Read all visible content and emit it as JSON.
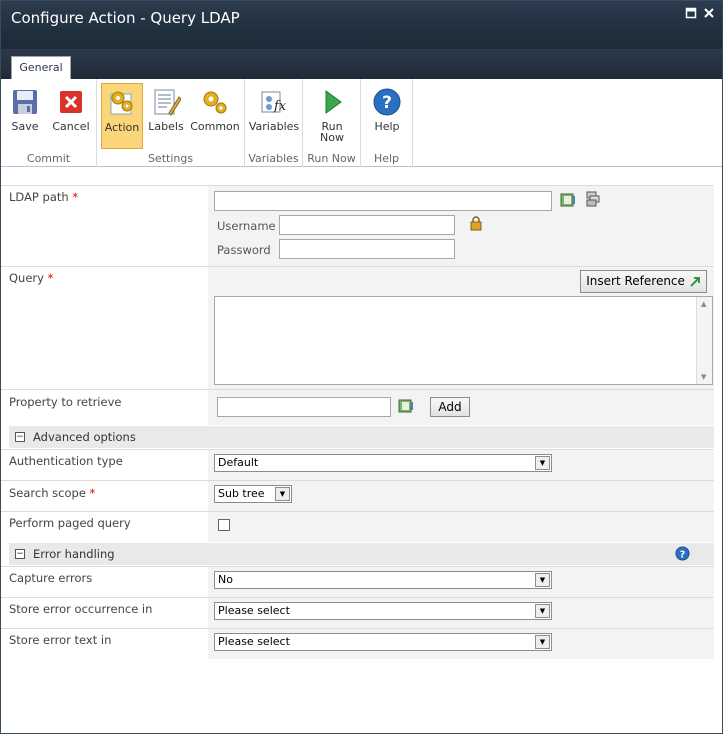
{
  "window": {
    "title": "Configure Action - Query LDAP"
  },
  "tab": {
    "label": "General"
  },
  "ribbon": {
    "commit": {
      "save": "Save",
      "cancel": "Cancel",
      "group": "Commit"
    },
    "settings": {
      "action": "Action",
      "labels": "Labels",
      "common": "Common",
      "group": "Settings"
    },
    "variables": {
      "variables": "Variables",
      "group": "Variables"
    },
    "runnow": {
      "run_line1": "Run",
      "run_line2": "Now",
      "group": "Run Now"
    },
    "help": {
      "help": "Help",
      "group": "Help"
    }
  },
  "form": {
    "ldap_path": {
      "label": "LDAP path",
      "required": "*",
      "value": ""
    },
    "username": {
      "label": "Username",
      "value": ""
    },
    "password": {
      "label": "Password",
      "value": ""
    },
    "query": {
      "label": "Query",
      "required": "*",
      "insert_reference": "Insert Reference",
      "value": ""
    },
    "property": {
      "label": "Property to retrieve",
      "value": "",
      "add": "Add"
    },
    "advanced": {
      "label": "Advanced options"
    },
    "auth": {
      "label": "Authentication type",
      "value": "Default"
    },
    "scope": {
      "label": "Search scope",
      "required": "*",
      "value": "Sub tree"
    },
    "paged": {
      "label": "Perform paged query",
      "checked": false
    },
    "errors": {
      "label": "Error handling"
    },
    "capture": {
      "label": "Capture errors",
      "value": "No"
    },
    "occurrence": {
      "label": "Store error occurrence in",
      "value": "Please select"
    },
    "errortext": {
      "label": "Store error text in",
      "value": "Please select"
    }
  },
  "icons": [
    "save-icon",
    "cancel-icon",
    "action-icon",
    "labels-icon",
    "common-icon",
    "variables-icon",
    "run-now-icon",
    "help-icon",
    "address-book-icon",
    "ldap-browse-icon",
    "lock-icon",
    "insert-reference-icon",
    "help-circle-icon"
  ],
  "colors": {
    "title_bar": "#21303f",
    "active_button": "#fbd57a",
    "required": "#dd0000"
  }
}
